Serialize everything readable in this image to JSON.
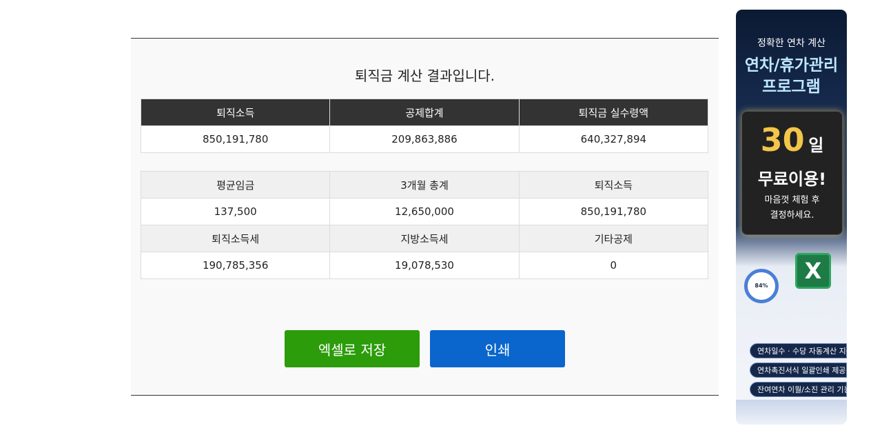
{
  "result": {
    "title": "퇴직금 계산 결과입니다.",
    "summary": {
      "headers": [
        "퇴직소득",
        "공제합계",
        "퇴직금 실수령액"
      ],
      "values": [
        "850,191,780",
        "209,863,886",
        "640,327,894"
      ]
    },
    "detail": {
      "row1_headers": [
        "평균임금",
        "3개월 총계",
        "퇴직소득"
      ],
      "row1_values": [
        "137,500",
        "12,650,000",
        "850,191,780"
      ],
      "row2_headers": [
        "퇴직소득세",
        "지방소득세",
        "기타공제"
      ],
      "row2_values": [
        "190,785,356",
        "19,078,530",
        "0"
      ]
    },
    "buttons": {
      "excel": "엑셀로 저장",
      "print": "인쇄"
    }
  },
  "ad": {
    "subtitle": "정확한 연차 계산",
    "title_line1": "연차/휴가관리",
    "title_line2": "프로그램",
    "days_number": "30",
    "days_unit": "일",
    "free": "무료이용!",
    "try_line1": "마음껏 체험 후",
    "try_line2": "결정하세요.",
    "ring_percent": "84%",
    "excel_icon_letter": "X",
    "features": [
      "연차일수 · 수당 자동계산 지원",
      "연차촉진서식 일괄인쇄 제공",
      "잔여연차 이월/소진 관리 기능"
    ],
    "colors": {
      "gold": "#f3c64a",
      "excel_green": "#1e7b45"
    }
  },
  "colors": {
    "header_dark": "#333333",
    "header_light": "#f0f0f0",
    "excel_button": "#2c9c0b",
    "print_button": "#0a66cc"
  }
}
